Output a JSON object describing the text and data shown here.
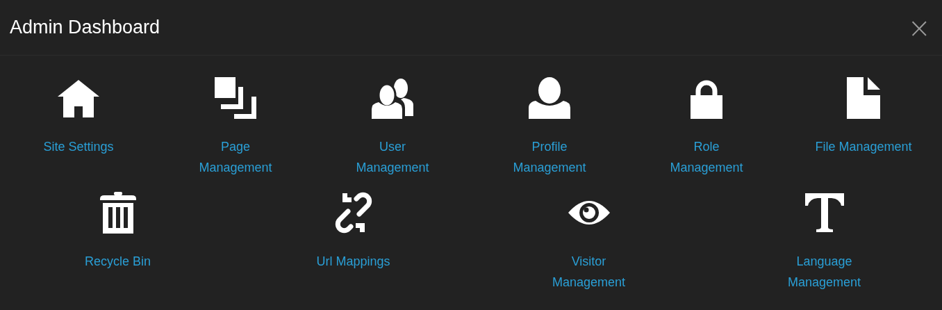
{
  "window": {
    "title": "Admin Dashboard",
    "close": "×"
  },
  "rows": [
    [
      {
        "kind": "home",
        "label": "Site Settings"
      },
      {
        "kind": "pages",
        "label": "Page\nManagement"
      },
      {
        "kind": "users",
        "label": "User\nManagement"
      },
      {
        "kind": "user",
        "label": "Profile\nManagement"
      },
      {
        "kind": "lock",
        "label": "Role\nManagement"
      },
      {
        "kind": "file",
        "label": "File Management"
      }
    ],
    [
      {
        "kind": "trash",
        "label": "Recycle Bin"
      },
      {
        "kind": "link",
        "label": "Url Mappings"
      },
      {
        "kind": "eye",
        "label": "Visitor\nManagement"
      },
      {
        "kind": "text",
        "label": "Language\nManagement"
      }
    ]
  ]
}
